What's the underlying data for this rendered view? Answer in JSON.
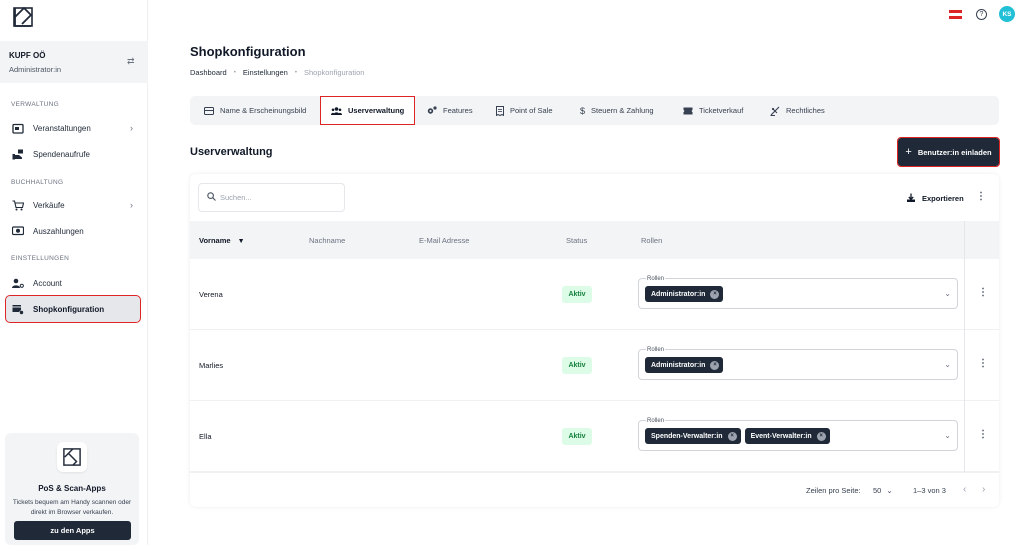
{
  "sidebar": {
    "org_name": "KUPF OÖ",
    "org_role": "Administrator:in",
    "sections": {
      "verwaltung": "VERWALTUNG",
      "buchhaltung": "BUCHHALTUNG",
      "einstellungen": "EINSTELLUNGEN"
    },
    "items": {
      "veranstaltungen": "Veranstaltungen",
      "spendenaufrufe": "Spendenaufrufe",
      "verkaeufe": "Verkäufe",
      "auszahlungen": "Auszahlungen",
      "account": "Account",
      "shopkonfiguration": "Shopkonfiguration"
    },
    "apps_card": {
      "title": "PoS & Scan-Apps",
      "description": "Tickets bequem am Handy scannen oder direkt im Browser verkaufen.",
      "button": "zu den Apps"
    }
  },
  "topbar": {
    "avatar_initials": "KS",
    "flag_colors": [
      "#dc2626",
      "#ffffff",
      "#dc2626"
    ],
    "help_glyph": "?"
  },
  "page": {
    "title": "Shopkonfiguration",
    "breadcrumb": [
      "Dashboard",
      "Einstellungen",
      "Shopkonfiguration"
    ]
  },
  "tabs": [
    {
      "label": "Name & Erscheinungsbild",
      "icon": "layout-icon"
    },
    {
      "label": "Userverwaltung",
      "icon": "users-icon",
      "active": true
    },
    {
      "label": "Features",
      "icon": "gears-icon"
    },
    {
      "label": "Point of Sale",
      "icon": "receipt-icon"
    },
    {
      "label": "Steuern & Zahlung",
      "icon": "dollar-icon"
    },
    {
      "label": "Ticketverkauf",
      "icon": "ticket-icon"
    },
    {
      "label": "Rechtliches",
      "icon": "scale-icon"
    }
  ],
  "users": {
    "heading": "Userverwaltung",
    "invite_button": "Benutzer:in einladen",
    "invite_plus": "+",
    "search_placeholder": "Suchen...",
    "export_label": "Exportieren",
    "columns": [
      "Vorname",
      "Nachname",
      "E-Mail Adresse",
      "Status",
      "Rollen"
    ],
    "roles_field_label": "Rollen",
    "rows": [
      {
        "first_name": "Verena",
        "status": "Aktiv",
        "roles": [
          "Administrator:in"
        ]
      },
      {
        "first_name": "Marlies",
        "status": "Aktiv",
        "roles": [
          "Administrator:in"
        ]
      },
      {
        "first_name": "Ella",
        "status": "Aktiv",
        "roles": [
          "Spenden-Verwalter:in",
          "Event-Verwalter:in"
        ]
      }
    ],
    "pagination": {
      "rows_per_page_label": "Zeilen pro Seite:",
      "rows_per_page_value": "50",
      "range": "1–3 von 3"
    }
  },
  "colors": {
    "accent_dark": "#1f2937",
    "status_green": "#15803d",
    "highlight_red": "#dc2626",
    "avatar": "#22c0d6"
  }
}
